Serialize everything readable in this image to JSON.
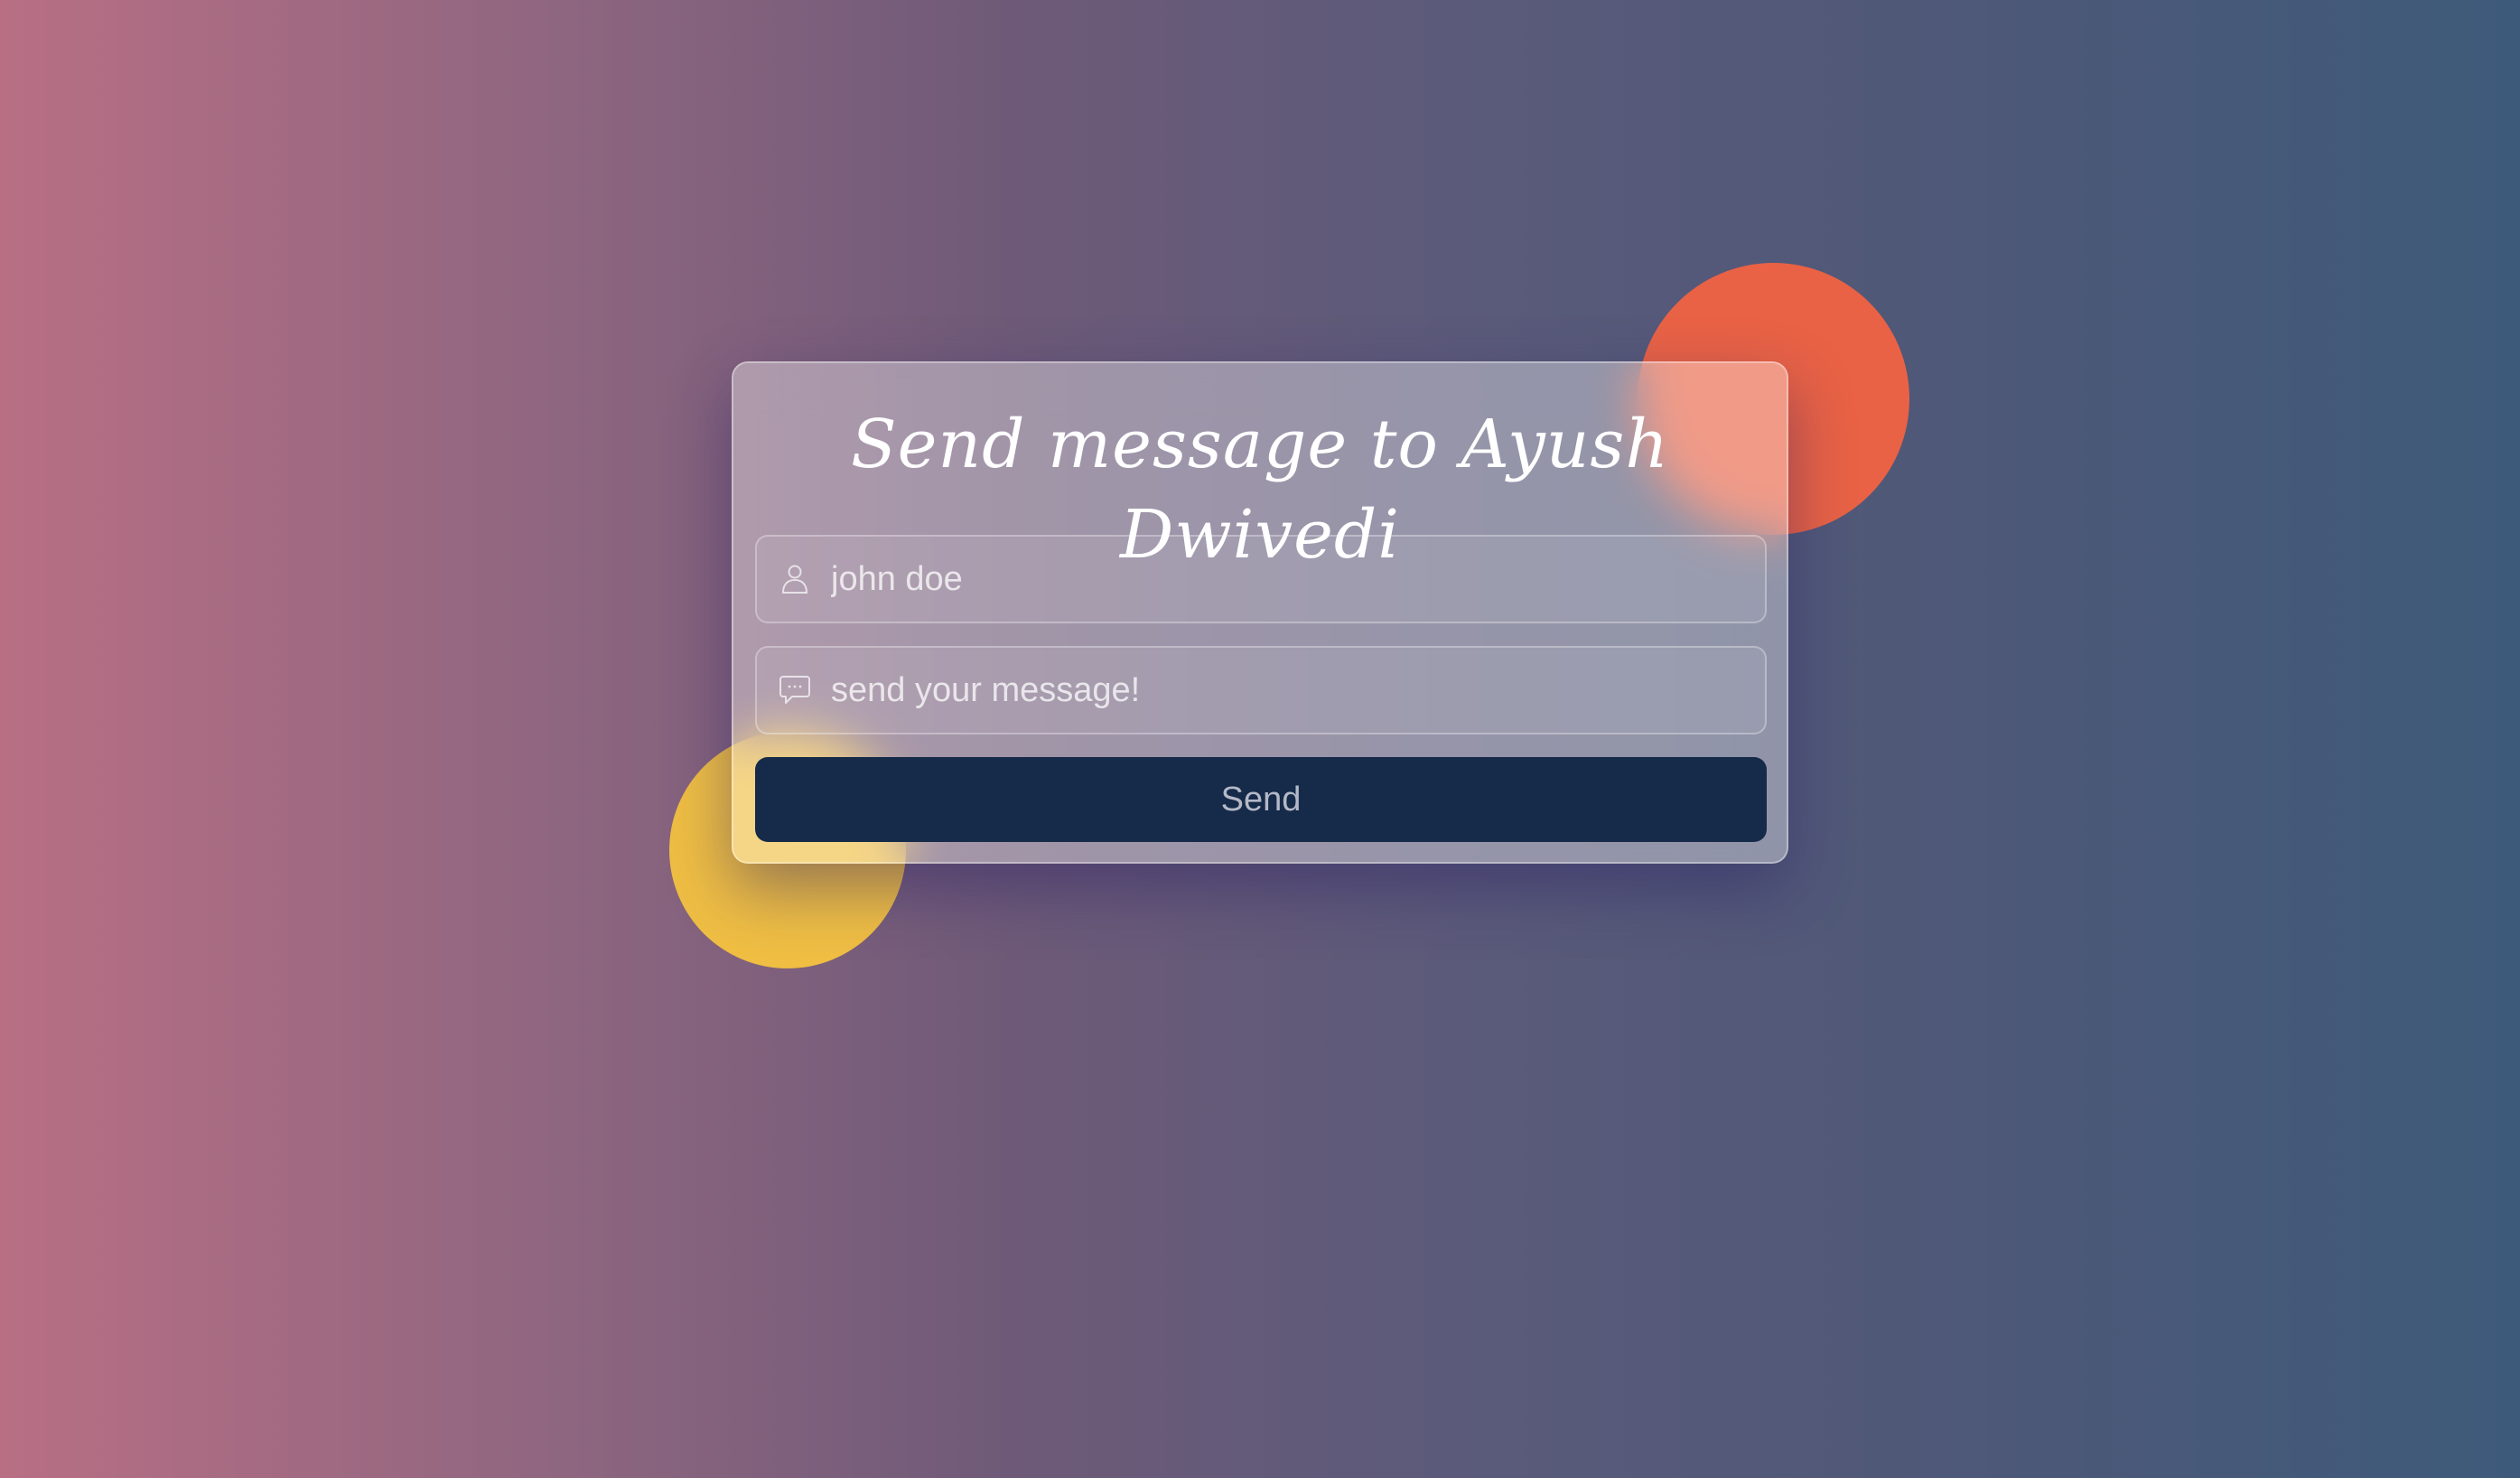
{
  "form": {
    "title": "Send message to Ayush Dwivedi",
    "name_field": {
      "value": "",
      "placeholder": "john doe",
      "icon": "user-icon"
    },
    "message_field": {
      "value": "",
      "placeholder": "send your message!",
      "icon": "chat-bubble-icon"
    },
    "send_label": "Send"
  },
  "colors": {
    "background_left": "#b86f84",
    "background_right": "#3e5a7a",
    "orange_circle": "#e96245",
    "yellow_circle": "#efbe43",
    "button_background": "#162a49",
    "title_text": "#ffffff"
  }
}
